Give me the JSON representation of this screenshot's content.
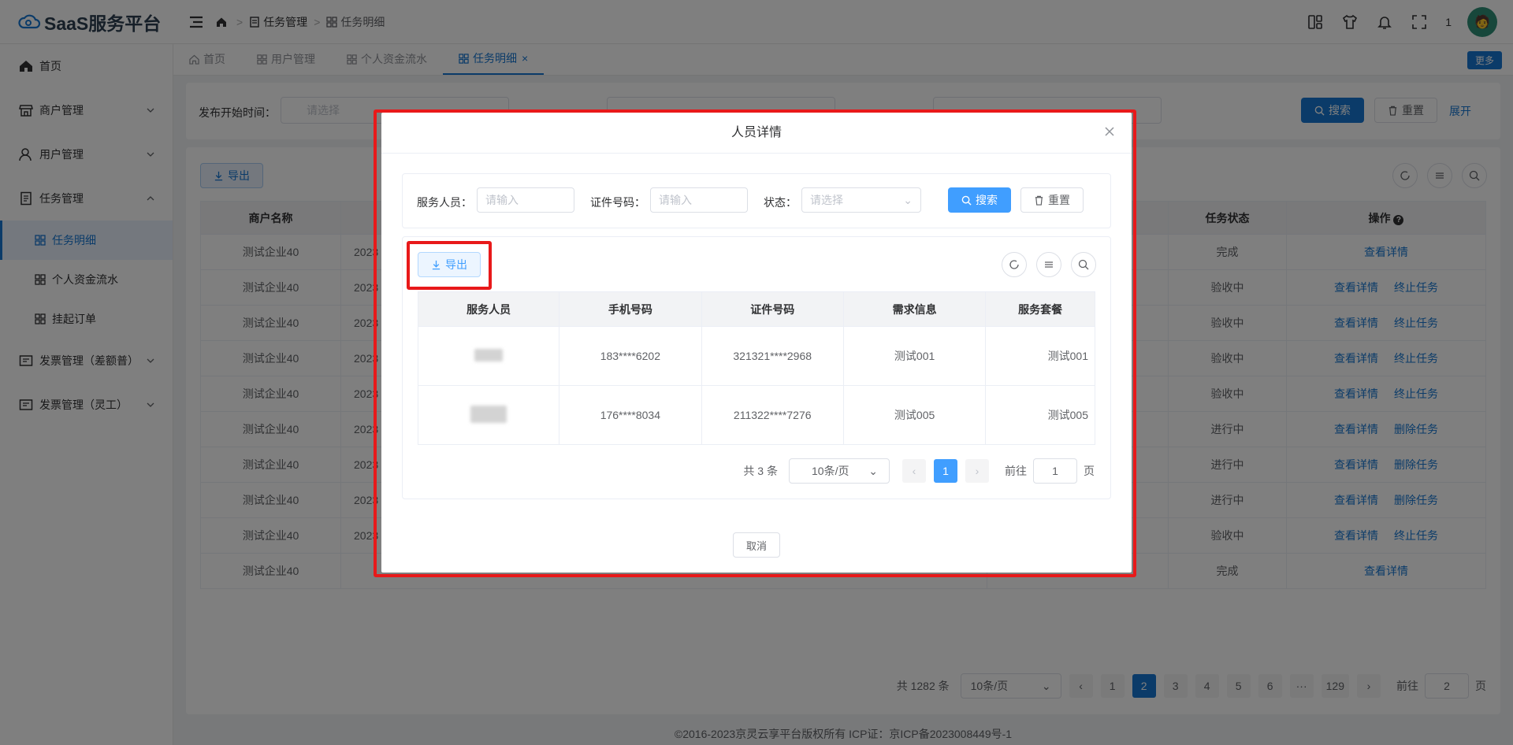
{
  "app": {
    "title": "SaaS服务平台"
  },
  "breadcrumb": {
    "level1": "任务管理",
    "level2": "任务明细"
  },
  "header": {
    "notification_count": "1",
    "avatar_text": "🧑"
  },
  "sidebar": {
    "home": "首页",
    "merchant": "商户管理",
    "user": "用户管理",
    "task": "任务管理",
    "task_sub": [
      "任务明细",
      "个人资金流水",
      "挂起订单"
    ],
    "invoice_diff": "发票管理（差额普）",
    "invoice_flex": "发票管理（灵工）"
  },
  "tags": {
    "home": "首页",
    "user": "用户管理",
    "funds": "个人资金流水",
    "task": "任务明细",
    "more": "更多"
  },
  "filters": {
    "publish_start_label": "发布开始时间：",
    "placeholder_select": "请选择",
    "search": "搜索",
    "reset": "重置",
    "expand": "展开"
  },
  "main": {
    "export": "导出",
    "columns": {
      "merchant": "商户名称",
      "status": "任务状态",
      "op": "操作"
    },
    "rows": [
      {
        "merchant": "测试企业40",
        "date": "2023",
        "status": "完成",
        "ops": [
          "查看详情"
        ]
      },
      {
        "merchant": "测试企业40",
        "date": "2023",
        "status": "验收中",
        "ops": [
          "查看详情",
          "终止任务"
        ]
      },
      {
        "merchant": "测试企业40",
        "date": "2023",
        "status": "验收中",
        "ops": [
          "查看详情",
          "终止任务"
        ]
      },
      {
        "merchant": "测试企业40",
        "date": "2023",
        "status": "验收中",
        "ops": [
          "查看详情",
          "终止任务"
        ]
      },
      {
        "merchant": "测试企业40",
        "date": "2023",
        "status": "验收中",
        "ops": [
          "查看详情",
          "终止任务"
        ]
      },
      {
        "merchant": "测试企业40",
        "date": "2023",
        "status": "进行中",
        "ops": [
          "查看详情",
          "删除任务"
        ]
      },
      {
        "merchant": "测试企业40",
        "date": "2023",
        "status": "进行中",
        "ops": [
          "查看详情",
          "删除任务"
        ]
      },
      {
        "merchant": "测试企业40",
        "date": "2023",
        "status": "进行中",
        "ops": [
          "查看详情",
          "删除任务"
        ]
      },
      {
        "merchant": "测试企业40",
        "date": "2023",
        "status": "验收中",
        "ops": [
          "查看详情",
          "终止任务"
        ]
      },
      {
        "merchant": "测试企业40",
        "date": "",
        "status": "完成",
        "ops": [
          "查看详情"
        ]
      }
    ],
    "pager": {
      "total": "共 1282 条",
      "size": "10条/页",
      "pages": [
        "1",
        "2",
        "3",
        "4",
        "5",
        "6",
        "···",
        "129"
      ],
      "current": "2",
      "goto": "前往",
      "goto_value": "2",
      "page_unit": "页"
    }
  },
  "footer": "©2016-2023京灵云享平台版权所有 ICP证：京ICP备2023008449号-1",
  "dialog": {
    "title": "人员详情",
    "labels": {
      "person": "服务人员：",
      "id": "证件号码：",
      "status": "状态："
    },
    "placeholders": {
      "input": "请输入",
      "select": "请选择"
    },
    "search": "搜索",
    "reset": "重置",
    "export": "导出",
    "columns": [
      "服务人员",
      "手机号码",
      "证件号码",
      "需求信息",
      "服务套餐"
    ],
    "rows": [
      {
        "phone": "183****6202",
        "id": "321321****2968",
        "demand": "测试001",
        "package": "测试001"
      },
      {
        "phone": "176****8034",
        "id": "211322****7276",
        "demand": "测试005",
        "package": "测试005"
      }
    ],
    "pager": {
      "total": "共 3 条",
      "size": "10条/页",
      "current": "1",
      "goto": "前往",
      "goto_value": "1",
      "page_unit": "页"
    },
    "cancel": "取消"
  },
  "colors": {
    "primary": "#409eff",
    "brand": "#1677d2",
    "highlight": "#e8191a"
  }
}
